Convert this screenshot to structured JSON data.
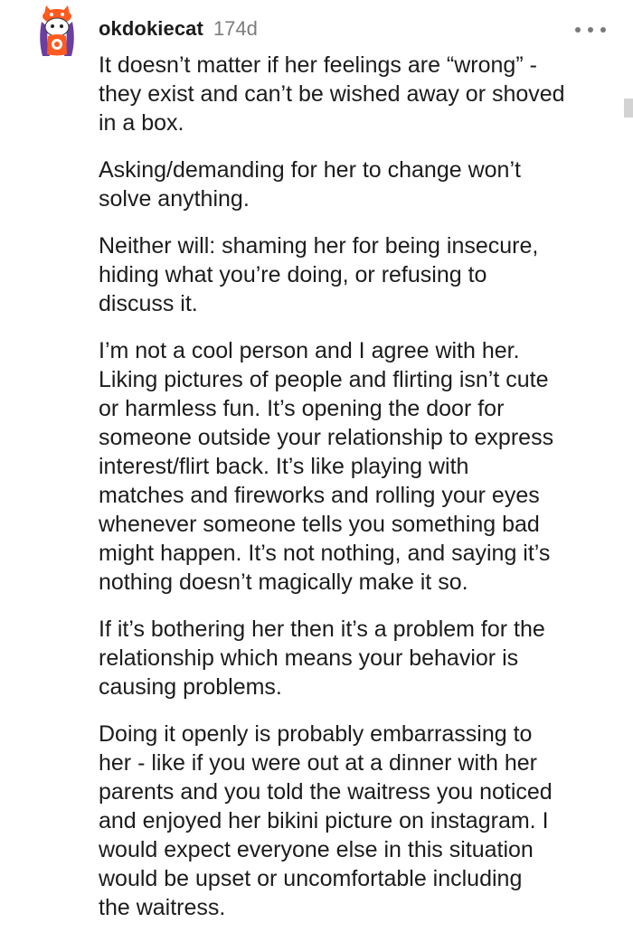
{
  "comment": {
    "author": "okdokiecat",
    "age": "174d",
    "avatar_icon": "snoo-avatar-icon",
    "more_icon": "more-options-icon",
    "paragraphs": [
      "It doesn’t matter if her feelings are “wrong” -\nthey exist and can’t be wished away or shoved\nin a box.",
      "Asking/demanding for her to change won’t\nsolve anything.",
      "Neither will: shaming her for being insecure,\nhiding what you’re doing, or refusing to\ndiscuss it.",
      "I’m not a cool person and I agree with her.\nLiking pictures of people and flirting isn’t cute\nor harmless fun. It’s opening the door for\nsomeone outside your relationship to express\ninterest/flirt back. It’s like playing with\nmatches and fireworks and rolling your eyes\nwhenever someone tells you something bad\nmight happen. It’s not nothing, and saying it’s\nnothing doesn’t magically make it so.",
      "If it’s bothering her then it’s a problem for the\nrelationship which means your behavior is\ncausing problems.",
      "Doing it openly is probably embarrassing to\nher - like if you were out at a dinner with her\nparents and you told the waitress you noticed\nand enjoyed her bikini picture on instagram. I\nwould expect everyone else in this situation\nwould be upset or uncomfortable including\nthe waitress."
    ]
  },
  "colors": {
    "text": "#1c1c1c",
    "meta": "#7c7c7c",
    "avatar_hair": "#6b3fa0",
    "avatar_accent": "#ff5a1f"
  }
}
